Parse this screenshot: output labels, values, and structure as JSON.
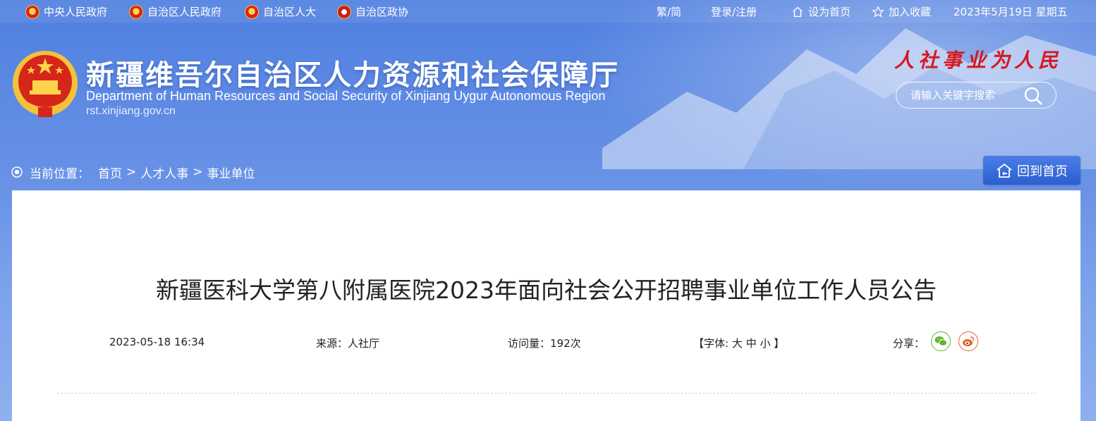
{
  "topbar": {
    "links": [
      {
        "label": "中央人民政府",
        "icon": "national-emblem-icon"
      },
      {
        "label": "自治区人民政府",
        "icon": "national-emblem-icon"
      },
      {
        "label": "自治区人大",
        "icon": "national-emblem-icon"
      },
      {
        "label": "自治区政协",
        "icon": "cppcc-emblem-icon"
      }
    ],
    "lang_toggle": "繁/简",
    "login": "登录/注册",
    "set_home": "设为首页",
    "favorite": "加入收藏",
    "date": "2023年5月19日 星期五"
  },
  "header": {
    "title_cn": "新疆维吾尔自治区人力资源和社会保障厅",
    "title_en": "Department of Human Resources and Social Security of Xinjiang Uygur Autonomous Region",
    "url": "rst.xinjiang.gov.cn",
    "slogan": "人社事业为人民",
    "search_placeholder": "请输入关键字搜索"
  },
  "breadcrumb": {
    "prefix": "当前位置：",
    "items": [
      "首页",
      "人才人事",
      "事业单位"
    ],
    "separator": ">"
  },
  "home_button": "回到首页",
  "article": {
    "title": "新疆医科大学第八附属医院2023年面向社会公开招聘事业单位工作人员公告",
    "date": "2023-05-18 16:34",
    "source": "来源：人社厅",
    "views": "访问量：192次",
    "font_prefix": "【字体:",
    "font_large": "大",
    "font_medium": "中",
    "font_small": "小",
    "font_suffix": "】",
    "share_label": "分享："
  },
  "colors": {
    "banner": "#5b86de",
    "slogan": "#d6181e",
    "wechat": "#5cb531",
    "weibo": "#e6632c"
  }
}
